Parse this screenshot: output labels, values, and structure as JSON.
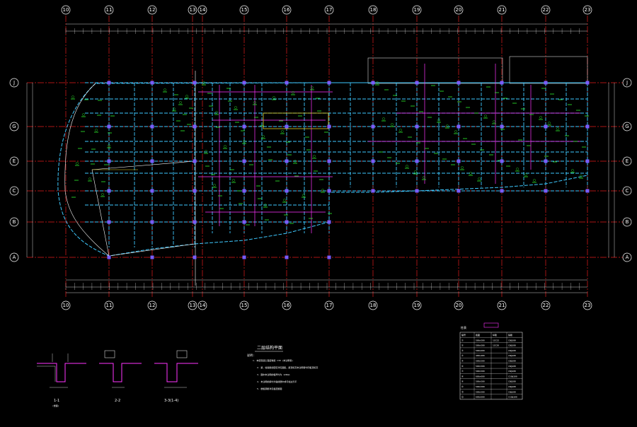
{
  "drawing": {
    "plan_title": "二层结构平面",
    "notes_heading": "说明:",
    "note_lines": [
      "1. 本层混凝土强度等级 C30 (未注明者)",
      "2. 梁、柱箍筋加密区详见图集，梁顶标高未注明者均同板顶标高",
      "3. 图中未注明的板厚均为 120mm",
      "4. 未注明的梁均为轴线居中或与柱边齐平",
      "5. 楼板钢筋详见板配筋图"
    ],
    "section_labels": [
      "1-1",
      "2-2",
      "3-3(1-4)"
    ],
    "section_sub": [
      "(楼面)",
      "",
      ""
    ],
    "table_title": "柱表",
    "table_header": [
      "编号",
      "截面",
      "纵筋",
      "箍筋"
    ],
    "table_rows": [
      [
        "①",
        "500x500",
        "12C22",
        "C8@100"
      ],
      [
        "②",
        "500x500",
        "12C20",
        "C8@100"
      ],
      [
        "③",
        "500x600",
        "",
        "C8@100"
      ],
      [
        "④",
        "400x400",
        "",
        "C8@100"
      ],
      [
        "⑤",
        "500x500",
        "",
        "C8@100"
      ],
      [
        "⑥",
        "500x500",
        "",
        "C8@100"
      ],
      [
        "⑦",
        "500x500",
        "",
        "C8@100"
      ],
      [
        "⑧",
        "600x600",
        "",
        "C10@100"
      ],
      [
        "⑨",
        "500x500",
        "",
        "C8@100"
      ],
      [
        "⑩",
        "500x500",
        "",
        "C8@100"
      ],
      [
        "⑪",
        "500x500",
        "",
        "C8@100"
      ],
      [
        "⑫",
        "600x600",
        "",
        "C10@100"
      ]
    ],
    "grid_v_labels": [
      "10",
      "11",
      "12",
      "13",
      "14",
      "15",
      "16",
      "17",
      "18",
      "19",
      "20",
      "21",
      "22",
      "23",
      "24"
    ],
    "grid_h_labels": [
      "J",
      "G",
      "E",
      "C",
      "B",
      "A"
    ],
    "colors": {
      "axis": "#e21b1b",
      "dim": "#ffffff",
      "beam": "#3ec9ff",
      "column": "#7a5cff",
      "rebar": "#2ef02e",
      "highlight": "#ff33ff",
      "yellow": "#e6d22a"
    }
  }
}
